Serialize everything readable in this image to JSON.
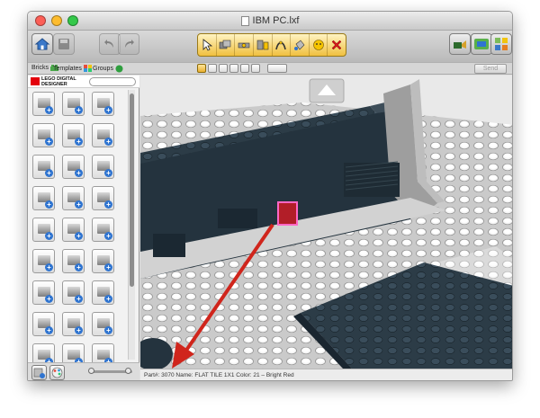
{
  "window": {
    "title": "IBM PC.lxf",
    "traffic_lights": [
      "#fc5f57",
      "#fdbc2e",
      "#34c84a"
    ]
  },
  "toolbar": {
    "left_buttons": [
      {
        "name": "home-icon",
        "enabled": true
      },
      {
        "name": "save-icon",
        "enabled": false
      },
      {
        "name": "undo-icon",
        "enabled": false
      },
      {
        "name": "redo-icon",
        "enabled": false
      }
    ],
    "tools": [
      "select-tool",
      "clone-tool",
      "hinge-tool",
      "hinge-align-tool",
      "flex-tool",
      "paint-tool",
      "hide-tool",
      "delete-tool"
    ],
    "right_buttons": [
      {
        "name": "camera-icon"
      },
      {
        "name": "build-mode-icon"
      },
      {
        "name": "view-mode-icon"
      }
    ]
  },
  "tabs": {
    "bricks": "Bricks",
    "templates": "Templates",
    "groups": "Groups",
    "send": "Send"
  },
  "palette": {
    "brand": "LEGO DIGITAL DESIGNER",
    "brand_color": "#e3000b",
    "items_count": 27
  },
  "status": {
    "text": "Part#: 3070 Name: FLAT TILE 1X1 Color: 21 – Bright Red"
  },
  "viewport": {
    "colors": {
      "baseplate": "#c8c8c8",
      "wall": "#2a3a45",
      "selected_brick": "#c0202a",
      "arrow": "#d0251c"
    }
  }
}
